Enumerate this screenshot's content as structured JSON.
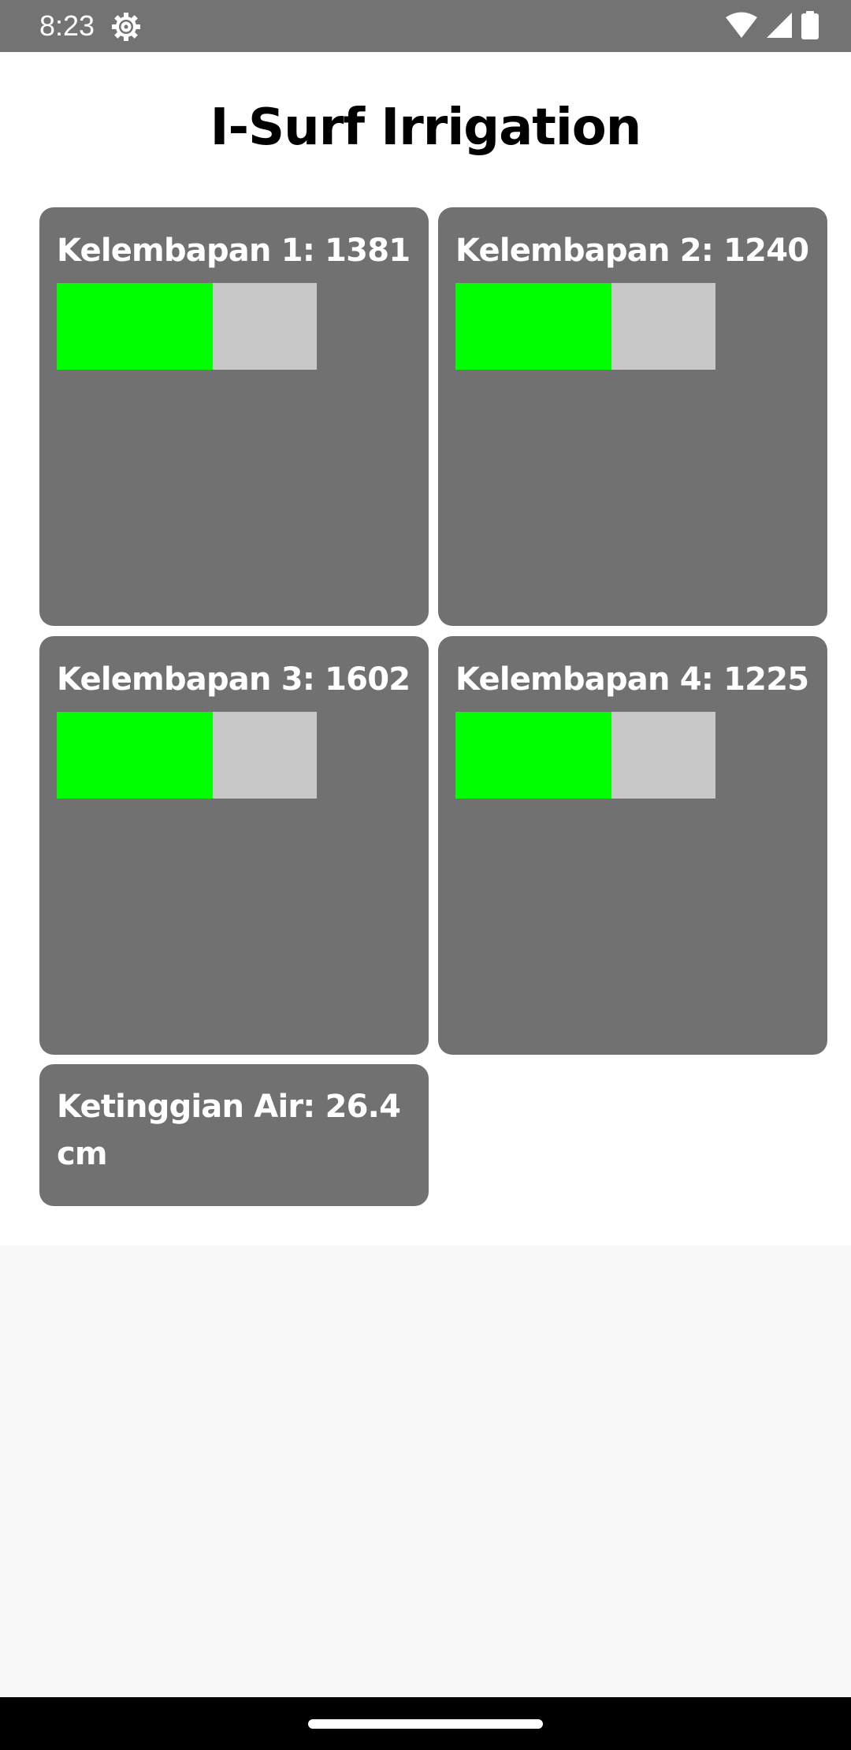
{
  "status_bar": {
    "time": "8:23",
    "icons": [
      "settings-gear-icon",
      "wifi-icon",
      "cellular-signal-icon",
      "battery-icon"
    ]
  },
  "app": {
    "title": "I-Surf Irrigation"
  },
  "sensors": [
    {
      "label": "Kelembapan 1: 1381",
      "fill_fraction": 0.6
    },
    {
      "label": "Kelembapan 2: 1240",
      "fill_fraction": 0.6
    },
    {
      "label": "Kelembapan 3: 1602",
      "fill_fraction": 0.6
    },
    {
      "label": "Kelembapan 4: 1225",
      "fill_fraction": 0.6
    }
  ],
  "water_level": {
    "label": "Ketinggian Air: 26.4 cm"
  },
  "colors": {
    "status_bar": "#737373",
    "card": "#717171",
    "bar_fill": "#00ff00",
    "bar_track": "#c8c8c8",
    "background": "#ffffff",
    "footer_area": "#f8f8f8"
  }
}
